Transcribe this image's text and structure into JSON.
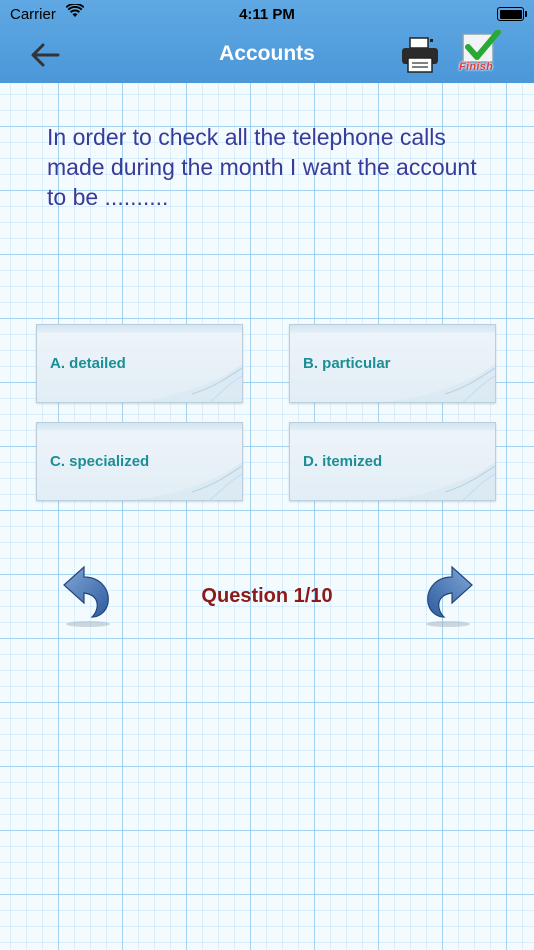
{
  "status_bar": {
    "carrier": "Carrier",
    "time": "4:11 PM"
  },
  "header": {
    "title": "Accounts",
    "finish_label": "Finish"
  },
  "question": {
    "text": "In order to check all the telephone calls made during the month I want the account to be .........."
  },
  "options": [
    {
      "label": "A. detailed"
    },
    {
      "label": "B. particular"
    },
    {
      "label": "C. specialized"
    },
    {
      "label": "D. itemized"
    }
  ],
  "progress": {
    "label": "Question 1/10",
    "current": 1,
    "total": 10
  },
  "colors": {
    "header_bg": "#4b97d8",
    "question_text": "#3a3a9a",
    "option_text": "#1b8f95",
    "counter_text": "#8b1a1a",
    "nav_arrow": "#3f6fb0",
    "finish_label": "#e23b3b"
  },
  "icons": [
    "back-arrow-icon",
    "printer-icon",
    "finish-checkmark-icon",
    "previous-arrow-icon",
    "next-arrow-icon",
    "wifi-icon",
    "battery-icon"
  ]
}
